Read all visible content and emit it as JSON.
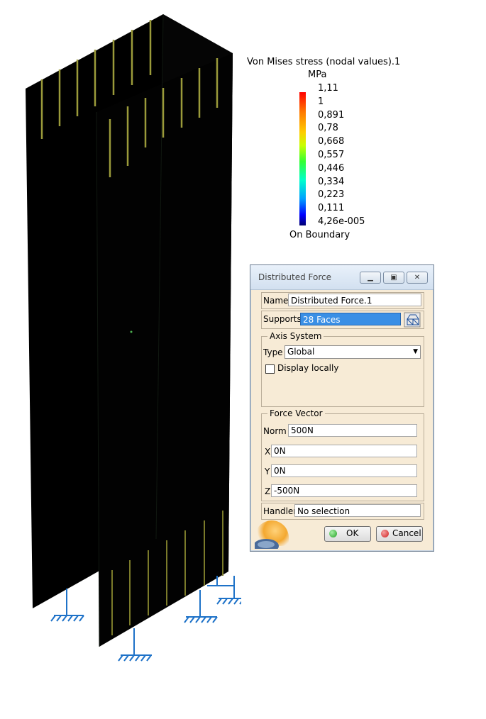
{
  "legend": {
    "title": "Von Mises stress (nodal values).1",
    "unit": "MPa",
    "values": [
      "1,11",
      "1",
      "0,891",
      "0,78",
      "0,668",
      "0,557",
      "0,446",
      "0,334",
      "0,223",
      "0,111",
      "4,26e-005"
    ],
    "footer": "On Boundary"
  },
  "dialog": {
    "title": "Distributed Force",
    "name_label": "Name",
    "name_value": "Distributed Force.1",
    "supports_label": "Supports",
    "supports_value": "28 Faces",
    "axis_group": "Axis System",
    "type_label": "Type",
    "type_value": "Global",
    "display_locally": "Display locally",
    "force_group": "Force Vector",
    "norm_label": "Norm",
    "norm_value": "500N",
    "x_label": "X",
    "x_value": "0N",
    "y_label": "Y",
    "y_value": "0N",
    "z_label": "Z",
    "z_value": "-500N",
    "handler_label": "Handler",
    "handler_value": "No selection",
    "ok_label": "OK",
    "cancel_label": "Cancel"
  },
  "colors": {
    "model": "#000000",
    "load_arrows": "#9a9a3a",
    "clamps": "#1e72c8",
    "ok_dot": "#22a022",
    "cancel_dot": "#d02020"
  }
}
